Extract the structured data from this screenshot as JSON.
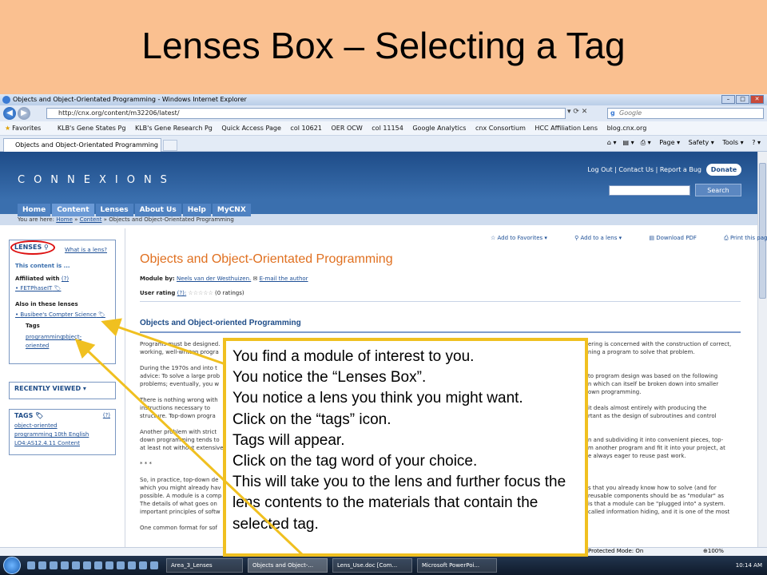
{
  "slide": {
    "title": "Lenses Box – Selecting a Tag"
  },
  "browser": {
    "window_title": "Objects and Object-Orientated Programming - Windows Internet Explorer",
    "url": "http://cnx.org/content/m32206/latest/",
    "search_placeholder": "Google",
    "favorites_label": "Favorites",
    "favorites": [
      "KLB's Gene States Pg",
      "KLB's Gene Research Pg",
      "Quick Access Page",
      "col 10621",
      "OER OCW",
      "col 11154",
      "Google Analytics",
      "cnx Consortium",
      "HCC Affiliation Lens",
      "blog.cnx.org"
    ],
    "tab_label": "Objects and Object-Orientated Programming",
    "command_bar": [
      "Page ▾",
      "Safety ▾",
      "Tools ▾"
    ]
  },
  "site": {
    "logo": "CONNEXIONS",
    "top_links": "Log Out | Contact Us | Report a Bug",
    "donate": "Donate",
    "search_btn": "Search",
    "nav": [
      "Home",
      "Content",
      "Lenses",
      "About Us",
      "Help",
      "MyCNX"
    ],
    "breadcrumb_prefix": "You are here:",
    "breadcrumb_home": "Home",
    "breadcrumb_content": "Content",
    "breadcrumb_current": "Objects and Object-Orientated Programming"
  },
  "lenses_box": {
    "heading": "LENSES",
    "what_is": "What is a lens?",
    "this_content": "This content is ...",
    "affiliated": "Affiliated with",
    "affiliated_q": "(?)",
    "affiliated_item": "FETPhaseIT",
    "also_in": "Also in these lenses",
    "also_item": "Busibee's Compter Science",
    "tags_label": "Tags",
    "tag1": "programming",
    "tag2": "object-",
    "tag3": "oriented"
  },
  "recently_viewed": "RECENTLY VIEWED ▾",
  "tags_box": {
    "heading": "TAGS",
    "q": "(?)",
    "line1": "object-oriented",
    "line2": "programming  10th  English",
    "line3": "LO4:AS12.4.11  Content"
  },
  "module": {
    "actions": [
      "Add to Favorites ▾",
      "Add to a lens ▾",
      "Download PDF",
      "Print this page"
    ],
    "title": "Objects and Object-Orientated Programming",
    "by_label": "Module by:",
    "author": "Neels van der Westhuizen.",
    "email": "E-mail the author",
    "rating_label": "User rating",
    "rating_q": "(?):",
    "rating_stars": "☆☆☆☆☆",
    "rating_count": "(0 ratings)",
    "section_heading": "Objects and Object-oriented Programming",
    "para_left": [
      "Programs must be designed.",
      "working, well-written progra",
      "",
      "During the 1970s and into t",
      "advice: To solve a large prob",
      "problems; eventually, you w",
      "",
      "There is nothing wrong with",
      "instructions necessary to",
      "structure. Top-down progra",
      "",
      "Another problem with strict",
      "down programming tends to",
      "at least not without extensive",
      "",
      "* * *",
      "",
      "So, in practice, top-down de",
      "which you might already hav",
      "possible. A module is a comp",
      "The details of what goes on",
      "important principles of softw",
      "",
      "One common format for sof"
    ],
    "para_right": [
      "ering is concerned with the construction of correct,",
      "ning a program to solve that problem.",
      "",
      "",
      "to program design was based on the following",
      "n which can itself be broken down into smaller",
      "own programming.",
      "",
      "it deals almost entirely with producing the",
      "rtant as the design of subroutines and control",
      "",
      "",
      "n and subdividing it into convenient pieces, top-",
      "m another program and fit it into your project, at",
      "e always eager to reuse past work.",
      "",
      "",
      "",
      "s that you already know how to solve (and for",
      "reusable components should be as \"modular\" as",
      "is that a module can be \"plugged into\" a system.",
      "called information hiding, and it is one of the most"
    ]
  },
  "statusbar": {
    "mode": "Protected Mode: On",
    "zoom": "100%"
  },
  "taskbar": {
    "tasks": [
      "Area_3_Lenses",
      "Objects and Object-...",
      "Lens_Use.doc [Com...",
      "Microsoft PowerPoi..."
    ],
    "time": "10:14 AM"
  },
  "callout": {
    "lines": [
      "You find a module of interest to you.",
      "You notice the “Lenses Box”.",
      "You notice a lens you think you might want.",
      "Click on the “tags” icon.",
      "Tags will appear.",
      "Click on the tag word of your choice.",
      "This will take you to the lens and further focus the lens contents to the materials that contain the selected tag."
    ]
  },
  "colors": {
    "slide_bg": "#fac090",
    "callout_border": "#f0c020",
    "module_title": "#e07020",
    "cnx_blue": "#1e4c88",
    "oval": "#dd1111"
  }
}
